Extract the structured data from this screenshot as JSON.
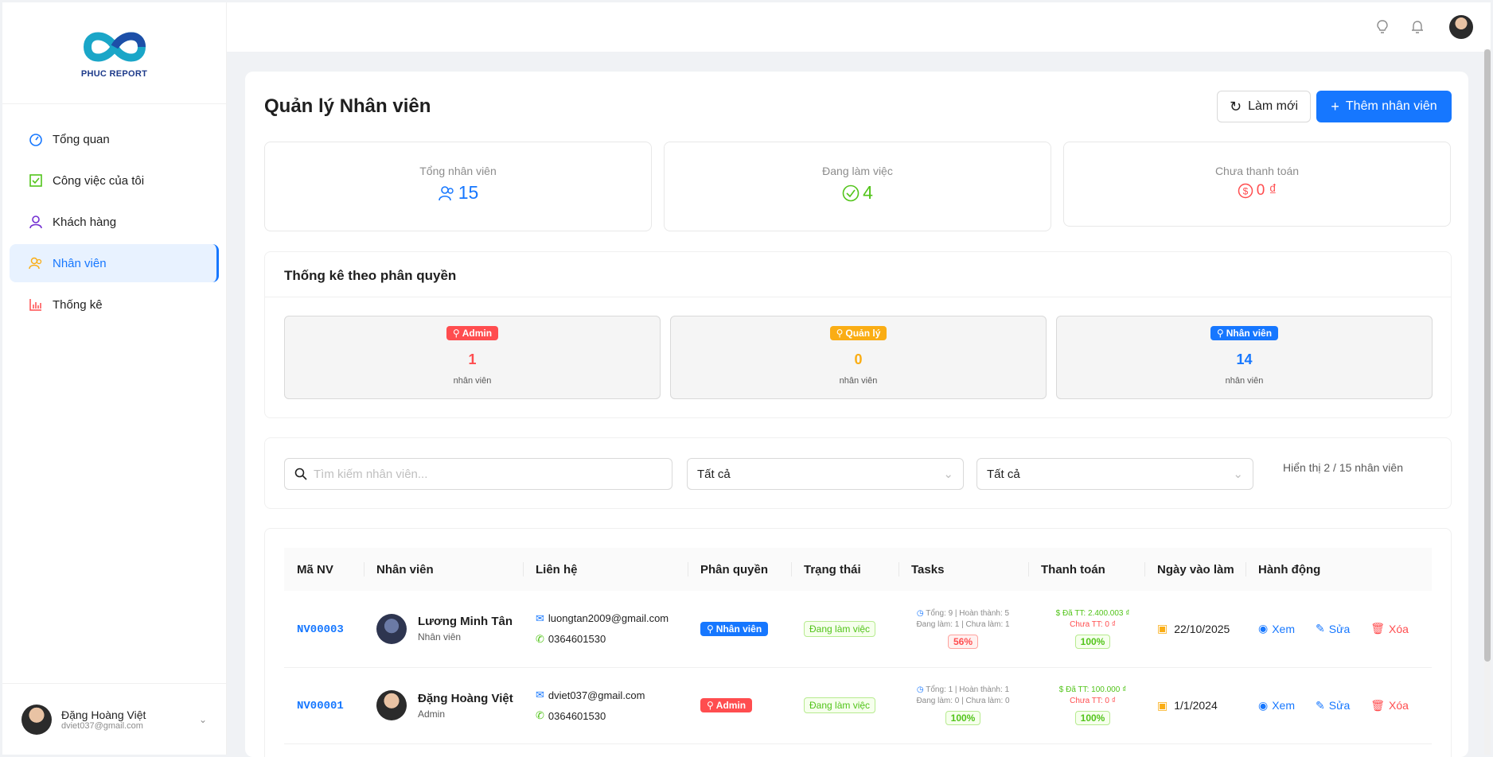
{
  "brand": {
    "name": "PHUC REPORT"
  },
  "sidebar": {
    "items": [
      {
        "label": "Tổng quan",
        "icon": "dashboard-icon"
      },
      {
        "label": "Công việc của tôi",
        "icon": "checkbox-icon"
      },
      {
        "label": "Khách hàng",
        "icon": "user-icon"
      },
      {
        "label": "Nhân viên",
        "icon": "team-icon",
        "active": true
      },
      {
        "label": "Thống kê",
        "icon": "bar-chart-icon"
      }
    ],
    "user": {
      "name": "Đặng Hoàng Việt",
      "email": "dviet037@gmail.com"
    }
  },
  "page": {
    "title": "Quản lý Nhân viên",
    "refresh_label": "Làm mới",
    "add_label": "Thêm nhân viên"
  },
  "stats": [
    {
      "label": "Tổng nhân viên",
      "value": "15",
      "color": "#1677ff"
    },
    {
      "label": "Đang làm việc",
      "value": "4",
      "color": "#52c41a"
    },
    {
      "label": "Chưa thanh toán",
      "value": "0 ₫",
      "color": "#ff4d4f"
    }
  ],
  "permissions": {
    "title": "Thống kê theo phân quyền",
    "unit": "nhân viên",
    "roles": [
      {
        "label": "Admin",
        "count": "1",
        "color": "#ff4d4f"
      },
      {
        "label": "Quản lý",
        "count": "0",
        "color": "#faad14"
      },
      {
        "label": "Nhân viên",
        "count": "14",
        "color": "#1677ff"
      }
    ]
  },
  "filters": {
    "search_placeholder": "Tìm kiếm nhân viên...",
    "role_select": "Tất cả",
    "status_select": "Tất cả",
    "count_text": "Hiển thị 2 / 15 nhân viên"
  },
  "table": {
    "columns": [
      "Mã NV",
      "Nhân viên",
      "Liên hệ",
      "Phân quyền",
      "Trạng thái",
      "Tasks",
      "Thanh toán",
      "Ngày vào làm",
      "Hành động"
    ],
    "actions": {
      "view": "Xem",
      "edit": "Sửa",
      "delete": "Xóa"
    },
    "rows": [
      {
        "code": "NV00003",
        "name": "Lương Minh Tân",
        "role_label": "Nhân viên",
        "email": "luongtan2009@gmail.com",
        "phone": "0364601530",
        "permission": "Nhân viên",
        "permission_color": "#1677ff",
        "status": "Đang làm việc",
        "tasks_line1": "Tổng: 9 | Hoàn thành: 5",
        "tasks_line2": "Đang làm: 1 | Chưa làm: 1",
        "tasks_pct": "56%",
        "tasks_pct_style": "red",
        "paid": "Đã TT: 2.400.003 ₫",
        "unpaid": "Chưa TT: 0 ₫",
        "pay_pct": "100%",
        "date": "22/10/2025"
      },
      {
        "code": "NV00001",
        "name": "Đặng Hoàng Việt",
        "role_label": "Admin",
        "email": "dviet037@gmail.com",
        "phone": "0364601530",
        "permission": "Admin",
        "permission_color": "#ff4d4f",
        "status": "Đang làm việc",
        "tasks_line1": "Tổng: 1 | Hoàn thành: 1",
        "tasks_line2": "Đang làm: 0 | Chưa làm: 0",
        "tasks_pct": "100%",
        "tasks_pct_style": "green",
        "paid": "Đã TT: 100.000 ₫",
        "unpaid": "Chưa TT: 0 ₫",
        "pay_pct": "100%",
        "date": "1/1/2024"
      }
    ]
  }
}
